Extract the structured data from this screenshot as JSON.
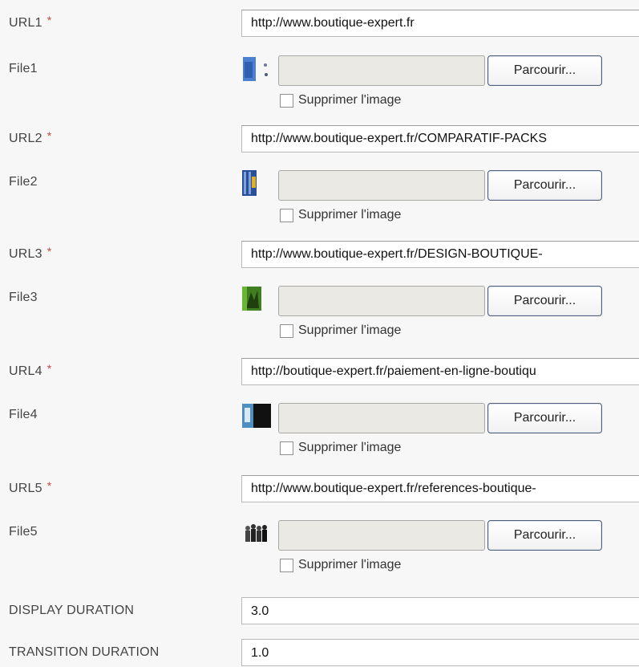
{
  "required_mark": "*",
  "browse_label": "Parcourir...",
  "delete_label": "Supprimer l'image",
  "entries": [
    {
      "url_label": "URL1",
      "url_value": "http://www.boutique-expert.fr",
      "file_label": "File1"
    },
    {
      "url_label": "URL2",
      "url_value": "http://www.boutique-expert.fr/COMPARATIF-PACKS",
      "file_label": "File2"
    },
    {
      "url_label": "URL3",
      "url_value": "http://www.boutique-expert.fr/DESIGN-BOUTIQUE-",
      "file_label": "File3"
    },
    {
      "url_label": "URL4",
      "url_value": "http://boutique-expert.fr/paiement-en-ligne-boutiqu",
      "file_label": "File4"
    },
    {
      "url_label": "URL5",
      "url_value": "http://www.boutique-expert.fr/references-boutique-",
      "file_label": "File5"
    }
  ],
  "display_duration": {
    "label": "DISPLAY DURATION",
    "value": "3.0"
  },
  "transition_duration": {
    "label": "TRANSITION DURATION",
    "value": "1.0"
  }
}
